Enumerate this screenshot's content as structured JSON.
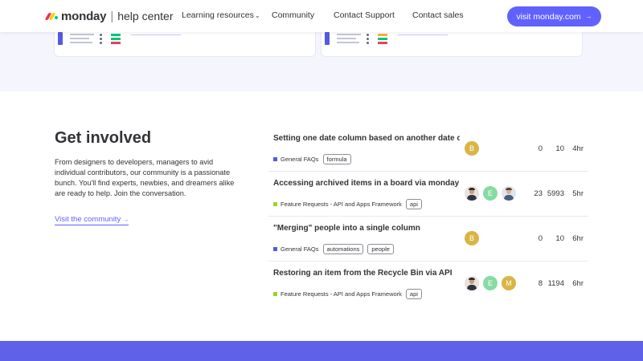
{
  "header": {
    "logo_word": "monday",
    "logo_separator": "|",
    "logo_sub": "help center",
    "nav": {
      "learning": "Learning resources",
      "community": "Community",
      "support": "Contact Support",
      "sales": "Contact sales"
    },
    "visit_button": "visit monday.com",
    "visit_arrow": "→"
  },
  "get_involved": {
    "title": "Get involved",
    "description": "From designers to developers, managers to avid individual contributors, our community is a passionate bunch. You'll find experts, newbies, and dreamers alike are ready to help. Join the conversation.",
    "link": "Visit the community",
    "link_arrow": "→"
  },
  "topics": [
    {
      "title": "Setting one date column based on another date column",
      "category": "General FAQs",
      "category_color": "#5559df",
      "tags": [
        "formula"
      ],
      "avatars": [
        {
          "type": "letter",
          "letter": "B",
          "color": "#d9b545"
        }
      ],
      "replies": "0",
      "views": "10",
      "activity": "4hr"
    },
    {
      "title": "Accessing archived items in a board via monday API",
      "category": "Feature Requests - API and Apps Framework",
      "category_color": "#9cd326",
      "tags": [
        "api"
      ],
      "avatars": [
        {
          "type": "photo"
        },
        {
          "type": "letter",
          "letter": "E",
          "color": "#86dba3"
        },
        {
          "type": "photo2"
        }
      ],
      "replies": "23",
      "views": "5993",
      "activity": "5hr"
    },
    {
      "title": "\"Merging\" people into a single column",
      "category": "General FAQs",
      "category_color": "#5559df",
      "tags": [
        "automations",
        "people"
      ],
      "avatars": [
        {
          "type": "letter",
          "letter": "B",
          "color": "#d9b545"
        }
      ],
      "replies": "0",
      "views": "10",
      "activity": "6hr"
    },
    {
      "title": "Restoring an item from the Recycle Bin via API",
      "category": "Feature Requests - API and Apps Framework",
      "category_color": "#9cd326",
      "tags": [
        "api"
      ],
      "avatars": [
        {
          "type": "photo"
        },
        {
          "type": "letter",
          "letter": "E",
          "color": "#86dba3"
        },
        {
          "type": "letter",
          "letter": "M",
          "color": "#d9b545"
        }
      ],
      "replies": "8",
      "views": "1194",
      "activity": "6hr"
    }
  ],
  "colors": {
    "accent": "#6161ff",
    "top_band": "#f4f5fd",
    "bottom_band": "#5f61e8"
  }
}
